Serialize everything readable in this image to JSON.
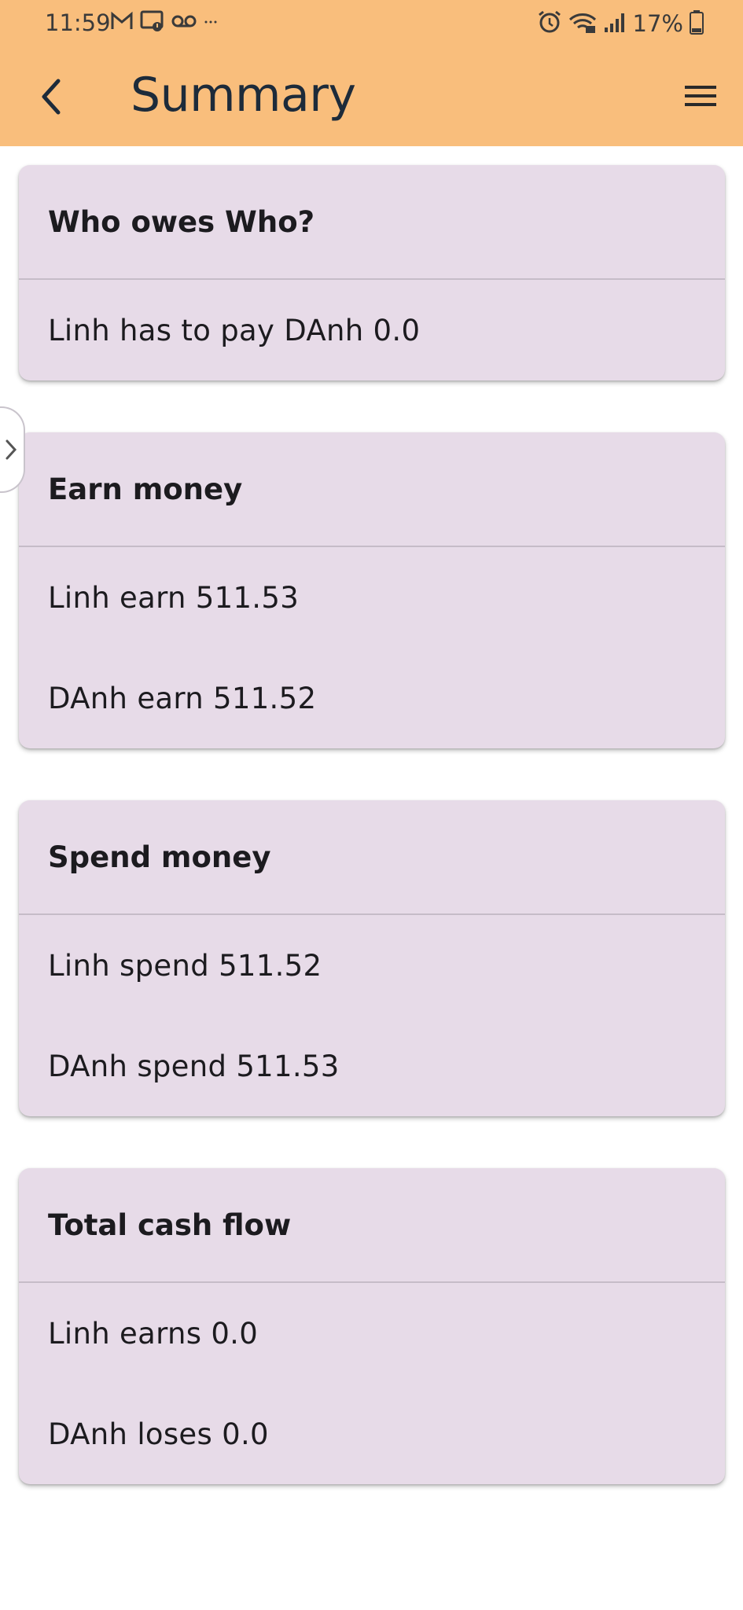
{
  "status_bar": {
    "time": "11:59",
    "battery": "17%",
    "left_icons": [
      "gmail-icon",
      "cast-notification-icon",
      "voicemail-icon",
      "more-notifications-icon"
    ],
    "right_icons": [
      "alarm-icon",
      "wifi-icon",
      "signal-icon",
      "battery-icon"
    ]
  },
  "app_bar": {
    "title": "Summary",
    "color": "#f9be7c"
  },
  "cards": [
    {
      "title": "Who owes Who?",
      "rows": [
        "Linh has to pay DAnh 0.0"
      ]
    },
    {
      "title": "Earn money",
      "rows": [
        "Linh earn 511.53",
        "DAnh earn 511.52"
      ]
    },
    {
      "title": "Spend money",
      "rows": [
        "Linh spend 511.52",
        "DAnh spend 511.53"
      ]
    },
    {
      "title": "Total cash flow",
      "rows": [
        "Linh earns 0.0",
        "DAnh loses 0.0"
      ]
    }
  ],
  "colors": {
    "card_background": "#e7dbe8",
    "text": "#1c1b1f"
  }
}
